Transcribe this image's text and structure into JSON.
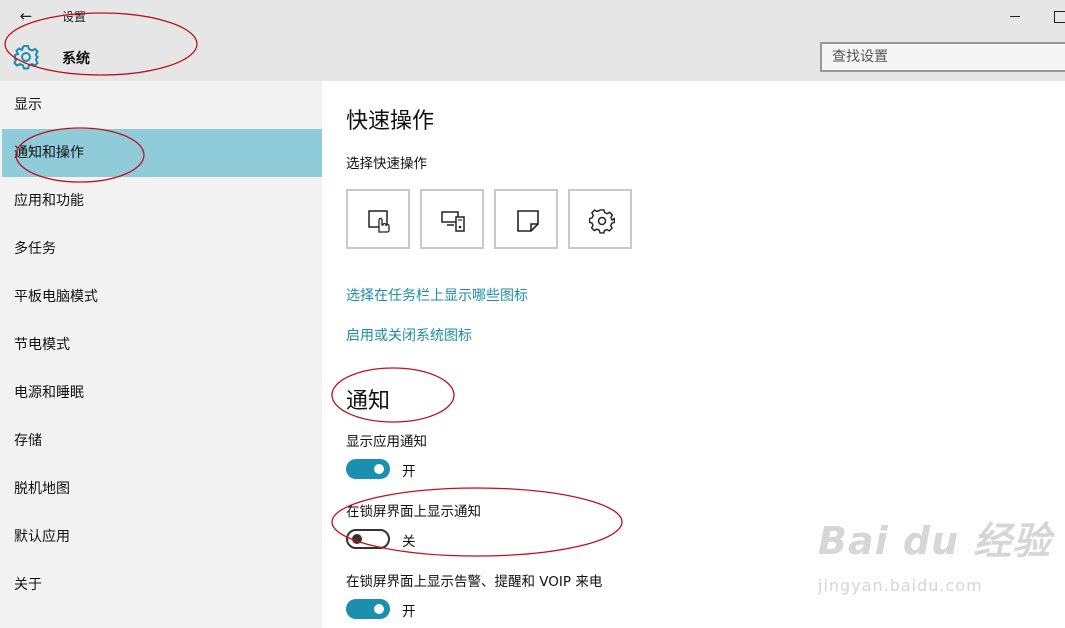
{
  "window": {
    "back_label": "←",
    "app_title": "设置"
  },
  "header": {
    "section_title": "系统",
    "search": {
      "placeholder": "查找设置"
    }
  },
  "sidebar": {
    "items": [
      {
        "label": "显示"
      },
      {
        "label": "通知和操作",
        "active": true
      },
      {
        "label": "应用和功能"
      },
      {
        "label": "多任务"
      },
      {
        "label": "平板电脑模式"
      },
      {
        "label": "节电模式"
      },
      {
        "label": "电源和睡眠"
      },
      {
        "label": "存储"
      },
      {
        "label": "脱机地图"
      },
      {
        "label": "默认应用"
      },
      {
        "label": "关于"
      }
    ]
  },
  "content": {
    "quick_actions": {
      "title": "快速操作",
      "subtitle": "选择快速操作",
      "tiles": [
        {
          "icon": "tablet-mode-icon"
        },
        {
          "icon": "project-icon"
        },
        {
          "icon": "note-icon"
        },
        {
          "icon": "settings-gear-icon"
        }
      ],
      "links": {
        "taskbar_icons": "选择在任务栏上显示哪些图标",
        "system_icons": "启用或关闭系统图标"
      }
    },
    "notifications": {
      "title": "通知",
      "settings": [
        {
          "label": "显示应用通知",
          "state": "开",
          "on": true
        },
        {
          "label": "在锁屏界面上显示通知",
          "state": "关",
          "on": false
        },
        {
          "label": "在锁屏界面上显示告警、提醒和 VOIP 来电",
          "state": "开",
          "on": true
        }
      ]
    }
  },
  "watermark": {
    "brand": "Bai du 经验",
    "url": "jingyan.baidu.com"
  },
  "colors": {
    "accent": "#1a8fb0",
    "active_nav": "#8fcbd8",
    "link": "#1a8fa6",
    "annotation": "#c0101a"
  }
}
